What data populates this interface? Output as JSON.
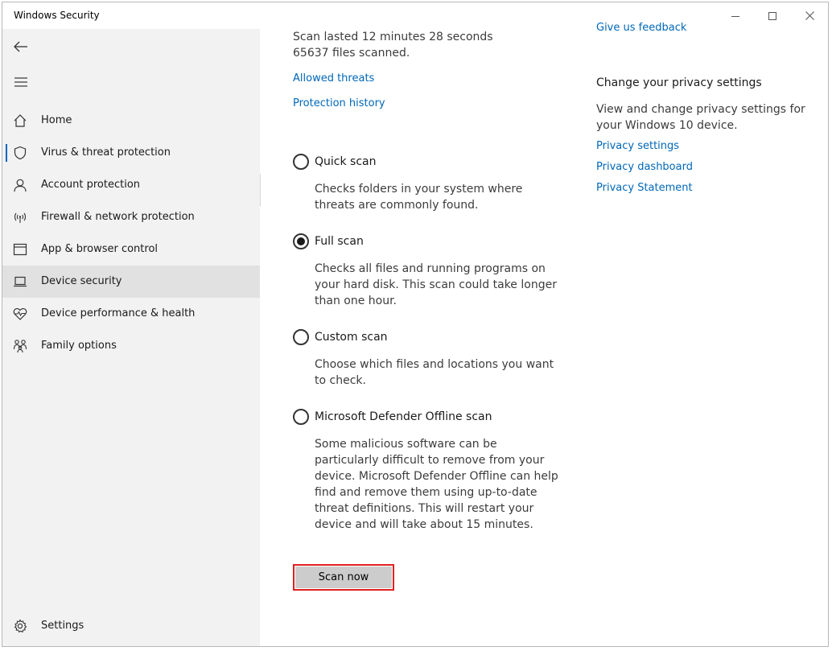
{
  "window": {
    "title": "Windows Security"
  },
  "sidebar": {
    "items": [
      {
        "label": "Home",
        "icon": "home-icon"
      },
      {
        "label": "Virus & threat protection",
        "icon": "shield-icon"
      },
      {
        "label": "Account protection",
        "icon": "person-icon"
      },
      {
        "label": "Firewall & network protection",
        "icon": "wifi-icon"
      },
      {
        "label": "App & browser control",
        "icon": "browser-window-icon"
      },
      {
        "label": "Device security",
        "icon": "laptop-icon"
      },
      {
        "label": "Device performance & health",
        "icon": "heart-pulse-icon"
      },
      {
        "label": "Family options",
        "icon": "family-icon"
      }
    ],
    "settings_label": "Settings"
  },
  "main": {
    "scan_duration": "Scan lasted 12 minutes 28 seconds",
    "files_scanned": "65637 files scanned.",
    "allowed_threats_link": "Allowed threats",
    "protection_history_link": "Protection history",
    "options": [
      {
        "label": "Quick scan",
        "description": "Checks folders in your system where threats are commonly found.",
        "selected": false
      },
      {
        "label": "Full scan",
        "description": "Checks all files and running programs on your hard disk. This scan could take longer than one hour.",
        "selected": true
      },
      {
        "label": "Custom scan",
        "description": "Choose which files and locations you want to check.",
        "selected": false
      },
      {
        "label": "Microsoft Defender Offline scan",
        "description": "Some malicious software can be particularly difficult to remove from your device. Microsoft Defender Offline can help find and remove them using up-to-date threat definitions. This will restart your device and will take about 15 minutes.",
        "selected": false
      }
    ],
    "scan_now_label": "Scan now"
  },
  "right_panel": {
    "feedback_link": "Give us feedback",
    "privacy_heading": "Change your privacy settings",
    "privacy_desc": "View and change privacy settings for your Windows 10 device.",
    "links": [
      "Privacy settings",
      "Privacy dashboard",
      "Privacy Statement"
    ]
  },
  "colors": {
    "accent": "#0067b8",
    "sidebar_bg": "#f2f2f2",
    "selected_bg": "#e1e1e1",
    "highlight": "#e02020"
  }
}
